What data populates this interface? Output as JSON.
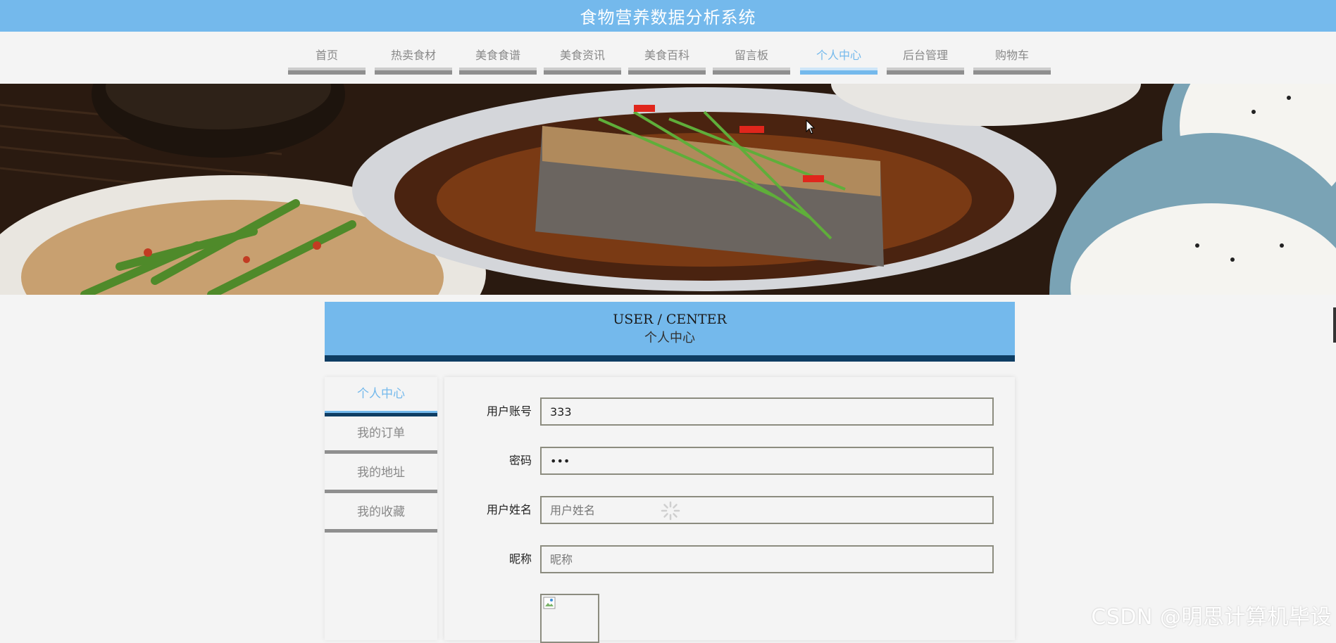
{
  "app": {
    "title": "食物营养数据分析系统"
  },
  "nav": {
    "items": [
      {
        "label": "首页"
      },
      {
        "label": "热卖食材"
      },
      {
        "label": "美食食谱"
      },
      {
        "label": "美食资讯"
      },
      {
        "label": "美食百科"
      },
      {
        "label": "留言板"
      },
      {
        "label": "个人中心"
      },
      {
        "label": "后台管理"
      },
      {
        "label": "购物车"
      }
    ],
    "active": "个人中心"
  },
  "banner": {
    "image": "food-banner-image"
  },
  "user_center": {
    "title_en": "USER / CENTER",
    "title_cn": "个人中心"
  },
  "sidebar": {
    "items": [
      {
        "label": "个人中心"
      },
      {
        "label": "我的订单"
      },
      {
        "label": "我的地址"
      },
      {
        "label": "我的收藏"
      }
    ],
    "active": "个人中心"
  },
  "form": {
    "account": {
      "label": "用户账号",
      "value": "333"
    },
    "password": {
      "label": "密码",
      "value": "•••"
    },
    "username": {
      "label": "用户姓名",
      "placeholder": "用户姓名"
    },
    "nickname": {
      "label": "昵称",
      "placeholder": "昵称"
    }
  },
  "watermark": "CSDN @明思计算机毕设",
  "colors": {
    "accent": "#74b9ec",
    "dark": "#0e3d63",
    "bar": "#8f8f8f"
  }
}
